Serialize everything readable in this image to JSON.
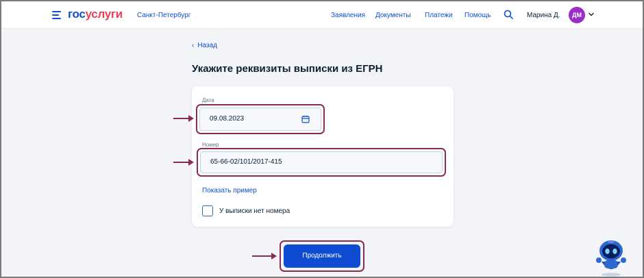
{
  "header": {
    "logo_part1": "гос",
    "logo_part2": "услуги",
    "region": "Санкт-Петербург",
    "nav": [
      "Заявления",
      "Документы",
      "Платежи",
      "Помощь"
    ],
    "user_name": "Марина Д.",
    "avatar_initials": "ДМ"
  },
  "page": {
    "back_label": "Назад",
    "title": "Укажите реквизиты выписки из ЕГРН"
  },
  "form": {
    "date_label": "Дата",
    "date_value": "09.08.2023",
    "number_label": "Номер",
    "number_value": "65-66-02/101/2017-415",
    "example_link": "Показать пример",
    "no_number_label": "У выписки нет номера",
    "no_number_checked": false,
    "submit_label": "Продолжить"
  },
  "colors": {
    "brand_blue": "#0d4cd3",
    "brand_red": "#ee3f58",
    "highlight": "#8b2a55",
    "avatar": "#9b2dc9"
  },
  "icons": [
    "menu-icon",
    "search-icon",
    "chevron-down-icon",
    "chevron-left-icon",
    "calendar-icon",
    "arrow-right-icon",
    "robot-assistant-icon"
  ]
}
